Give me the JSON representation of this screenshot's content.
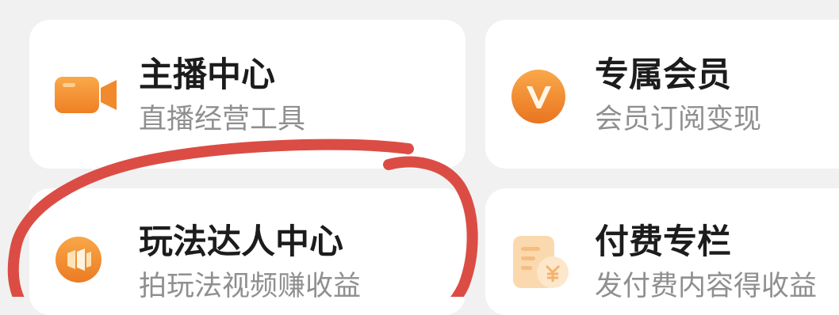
{
  "cards": [
    {
      "title": "主播中心",
      "subtitle": "直播经营工具",
      "icon": "video-camera-icon"
    },
    {
      "title": "专属会员",
      "subtitle": "会员订阅变现",
      "icon": "vip-v-icon"
    },
    {
      "title": "玩法达人中心",
      "subtitle": "拍玩法视频赚收益",
      "icon": "game-expert-icon"
    },
    {
      "title": "付费专栏",
      "subtitle": "发付费内容得收益",
      "icon": "paid-column-icon"
    }
  ],
  "colors": {
    "accent_orange": "#f08a2c",
    "annotation_red": "#d9433a",
    "background": "#f1f1f1",
    "card": "#ffffff"
  }
}
